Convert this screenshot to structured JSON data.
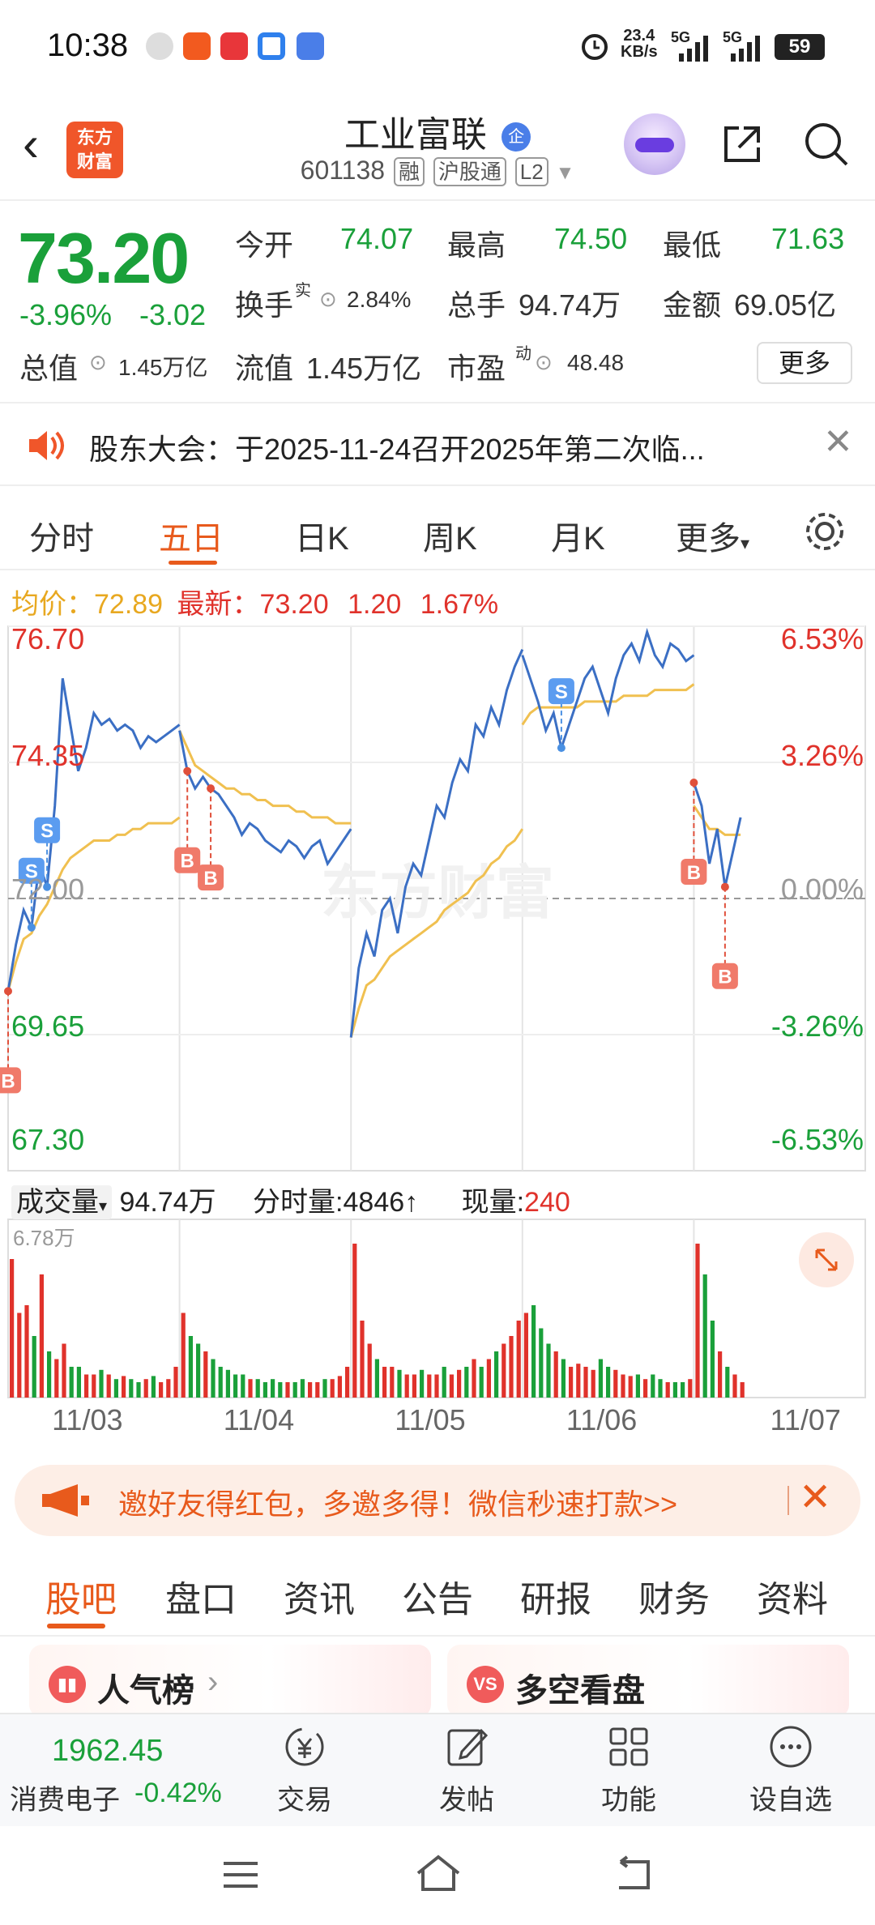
{
  "status_bar": {
    "time": "10:38",
    "net_speed": "23.4",
    "net_unit": "KB/s",
    "signal1": "5G",
    "signal2": "5G",
    "battery": "59",
    "notif_icons": [
      "settings-icon",
      "taobao-icon",
      "tieba-icon",
      "blue-app-icon",
      "browser-icon"
    ]
  },
  "header": {
    "back": "‹",
    "logo_line1": "东方",
    "logo_line2": "财富",
    "stock_name": "工业富联",
    "stock_badge": "企",
    "stock_code": "601138",
    "tags": [
      "融",
      "沪股通",
      "L2"
    ]
  },
  "quote": {
    "price": "73.20",
    "change_pct": "-3.96%",
    "change": "-3.02",
    "open_label": "今开",
    "open": "74.07",
    "high_label": "最高",
    "high": "74.50",
    "low_label": "最低",
    "low": "71.63",
    "turnover_label": "换手",
    "turnover_sup": "实",
    "turnover": "2.84%",
    "volume_label": "总手",
    "volume": "94.74万",
    "amount_label": "金额",
    "amount": "69.05亿",
    "mktcap_label": "总值",
    "mktcap": "1.45万亿",
    "float_label": "流值",
    "float": "1.45万亿",
    "pe_label": "市盈",
    "pe_sup": "动",
    "pe": "48.48",
    "more": "更多"
  },
  "notice": {
    "text": "股东大会：于2025-11-24召开2025年第二次临..."
  },
  "chart_tabs": {
    "items": [
      "分时",
      "五日",
      "日K",
      "周K",
      "月K",
      "更多"
    ],
    "active": "五日"
  },
  "avg_row": {
    "avg_label": "均价：",
    "avg": "72.89",
    "latest_label": "最新：",
    "latest": "73.20",
    "chg": "1.20",
    "pct": "1.67%"
  },
  "volume_row": {
    "label": "成交量",
    "total": "94.74万",
    "tick_label": "分时量:",
    "tick": "4846",
    "tick_arrow": "↑",
    "now_label": "现量:",
    "now": "240"
  },
  "chart_data": {
    "type": "line",
    "left_ticks": [
      "76.70",
      "74.35",
      "72.00",
      "69.65",
      "67.30"
    ],
    "right_ticks": [
      "6.53%",
      "3.26%",
      "0.00%",
      "-3.26%",
      "-6.53%"
    ],
    "ylim": [
      67.3,
      76.7
    ],
    "reference": 72.0,
    "x_labels": [
      "11/03",
      "11/04",
      "11/05",
      "11/06",
      "11/07"
    ],
    "volume_max_label": "6.78万",
    "days": [
      {
        "price": [
          70.4,
          71.2,
          71.8,
          71.5,
          72.6,
          72.2,
          73.6,
          75.8,
          75.0,
          74.2,
          74.6,
          75.2,
          75.0,
          75.1,
          74.9,
          75.0,
          74.9,
          74.6,
          74.8,
          74.7,
          74.8,
          74.9,
          75.0
        ],
        "avg": [
          70.4,
          70.9,
          71.3,
          71.4,
          71.7,
          71.9,
          72.2,
          72.5,
          72.7,
          72.8,
          72.9,
          73.0,
          73.0,
          73.0,
          73.1,
          73.1,
          73.2,
          73.2,
          73.3,
          73.3,
          73.3,
          73.3,
          73.4
        ],
        "volume": [
          0.9,
          0.55,
          0.6,
          0.4,
          0.8,
          0.3,
          0.25,
          0.35,
          0.2,
          0.2,
          0.15,
          0.15,
          0.18,
          0.15,
          0.12,
          0.14,
          0.12,
          0.1,
          0.12,
          0.14,
          0.1,
          0.12,
          0.2
        ]
      },
      {
        "price": [
          74.9,
          74.2,
          73.9,
          74.1,
          73.9,
          73.8,
          73.6,
          73.4,
          73.1,
          73.3,
          73.2,
          73.0,
          72.9,
          72.8,
          73.0,
          72.9,
          72.7,
          72.9,
          73.0,
          72.6,
          72.8,
          73.0,
          73.2
        ],
        "avg": [
          74.9,
          74.6,
          74.3,
          74.2,
          74.1,
          74.0,
          73.9,
          73.9,
          73.8,
          73.8,
          73.7,
          73.7,
          73.6,
          73.6,
          73.6,
          73.5,
          73.5,
          73.4,
          73.4,
          73.4,
          73.3,
          73.3,
          73.3
        ],
        "volume": [
          0.55,
          0.4,
          0.35,
          0.3,
          0.25,
          0.2,
          0.18,
          0.15,
          0.15,
          0.12,
          0.12,
          0.1,
          0.12,
          0.1,
          0.1,
          0.1,
          0.12,
          0.1,
          0.1,
          0.12,
          0.12,
          0.14,
          0.2
        ]
      },
      {
        "price": [
          69.6,
          70.8,
          71.4,
          71.0,
          71.8,
          72.0,
          71.4,
          72.2,
          72.6,
          72.4,
          73.0,
          73.6,
          73.4,
          74.0,
          74.4,
          74.2,
          75.0,
          74.8,
          75.3,
          75.0,
          75.6,
          76.0,
          76.3
        ],
        "avg": [
          69.6,
          70.1,
          70.5,
          70.6,
          70.8,
          71.0,
          71.1,
          71.2,
          71.3,
          71.4,
          71.5,
          71.6,
          71.8,
          71.9,
          72.0,
          72.1,
          72.3,
          72.4,
          72.6,
          72.7,
          72.9,
          73.0,
          73.2
        ],
        "volume": [
          1.0,
          0.5,
          0.35,
          0.25,
          0.2,
          0.2,
          0.18,
          0.15,
          0.15,
          0.18,
          0.15,
          0.15,
          0.2,
          0.15,
          0.18,
          0.2,
          0.25,
          0.2,
          0.25,
          0.3,
          0.35,
          0.4,
          0.5
        ]
      },
      {
        "price": [
          76.2,
          75.8,
          75.4,
          74.9,
          75.2,
          74.6,
          75.0,
          75.4,
          75.8,
          76.0,
          75.6,
          75.2,
          75.8,
          76.2,
          76.4,
          76.1,
          76.6,
          76.2,
          76.0,
          76.4,
          76.3,
          76.1,
          76.2
        ],
        "avg": [
          75.0,
          75.2,
          75.3,
          75.3,
          75.3,
          75.3,
          75.3,
          75.3,
          75.4,
          75.4,
          75.4,
          75.4,
          75.4,
          75.5,
          75.5,
          75.5,
          75.5,
          75.6,
          75.6,
          75.6,
          75.6,
          75.6,
          75.7
        ],
        "volume": [
          0.55,
          0.6,
          0.45,
          0.35,
          0.3,
          0.25,
          0.2,
          0.22,
          0.2,
          0.18,
          0.25,
          0.2,
          0.18,
          0.15,
          0.14,
          0.15,
          0.12,
          0.15,
          0.12,
          0.1,
          0.1,
          0.1,
          0.12
        ]
      },
      {
        "price": [
          74.0,
          73.6,
          72.6,
          73.2,
          72.2,
          72.8,
          73.4
        ],
        "avg": [
          73.6,
          73.4,
          73.2,
          73.2,
          73.1,
          73.1,
          73.1
        ],
        "volume": [
          1.0,
          0.8,
          0.5,
          0.3,
          0.2,
          0.15,
          0.1
        ]
      }
    ],
    "markers": [
      {
        "label": "S",
        "day": 0,
        "index": 5
      },
      {
        "label": "S",
        "day": 0,
        "index": 3
      },
      {
        "label": "B",
        "day": 0,
        "index": 0
      },
      {
        "label": "B",
        "day": 1,
        "index": 1
      },
      {
        "label": "B",
        "day": 1,
        "index": 4
      },
      {
        "label": "S",
        "day": 3,
        "index": 5
      },
      {
        "label": "B",
        "day": 4,
        "index": 0
      },
      {
        "label": "B",
        "day": 4,
        "index": 4
      }
    ],
    "watermark": "东方财富",
    "colors": {
      "price": "#3b6fc4",
      "avg": "#f0c050",
      "up": "#e0322b",
      "down": "#1aa03a"
    }
  },
  "banner": {
    "text": "邀好友得红包，多邀多得！微信秒速打款>>"
  },
  "bottom_tabs": {
    "items": [
      "股吧",
      "盘口",
      "资讯",
      "公告",
      "研报",
      "财务",
      "资料"
    ],
    "active": "股吧"
  },
  "cards": [
    {
      "icon": "bar-chart-icon",
      "label": "人气榜",
      "arrow": "›"
    },
    {
      "icon": "vs-icon",
      "icon_text": "VS",
      "label": "多空看盘"
    }
  ],
  "bottom_nav": {
    "index_value": "1962.45",
    "index_name": "消费电子",
    "index_pct": "-0.42%",
    "items": [
      {
        "label": "交易",
        "icon": "yen-exchange-icon"
      },
      {
        "label": "发帖",
        "icon": "edit-post-icon"
      },
      {
        "label": "功能",
        "icon": "grid-icon"
      },
      {
        "label": "设自选",
        "icon": "more-dots-icon"
      }
    ]
  }
}
